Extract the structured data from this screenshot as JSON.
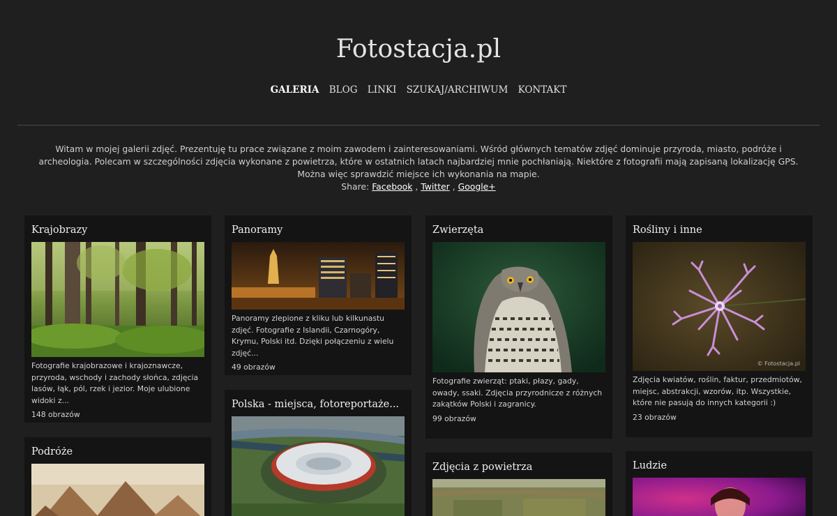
{
  "site": {
    "title": "Fotostacja.pl"
  },
  "nav": {
    "items": [
      {
        "label": "GALERIA",
        "active": true
      },
      {
        "label": "BLOG",
        "active": false
      },
      {
        "label": "LINKI",
        "active": false
      },
      {
        "label": "SZUKAJ/ARCHIWUM",
        "active": false
      },
      {
        "label": "KONTAKT",
        "active": false
      }
    ]
  },
  "intro": {
    "text": "Witam w mojej galerii zdjęć. Prezentuję tu prace związane z moim zawodem i zainteresowaniami. Wśród głównych tematów zdjęć dominuje przyroda, miasto, podróże i archeologia. Polecam w szczególności zdjęcia wykonane z powietrza, które w ostatnich latach najbardziej mnie pochłaniają. Niektóre z fotografii mają zapisaną lokalizację GPS. Można więc sprawdzić miejsce ich wykonania na mapie.",
    "share_label": "Share:",
    "share_links": [
      "Facebook",
      "Twitter",
      "Google+"
    ]
  },
  "galleries": [
    {
      "title": "Krajobrazy",
      "description": "Fotografie krajobrazowe i krajoznawcze, przyroda, wschody i zachody słońca, zdjęcia lasów, łąk, pól, rzek i jezior. Moje ulubione widoki z...",
      "count": "148 obrazów",
      "image": "forest-photo"
    },
    {
      "title": "Panoramy",
      "description": "Panoramy zlepione z kliku lub kilkunastu zdjęć. Fotografie z Islandii, Czarnogóry, Krymu, Polski itd. Dzięki połączeniu z wielu zdjęć...",
      "count": "49 obrazów",
      "image": "warsaw-night-panorama"
    },
    {
      "title": "Zwierzęta",
      "description": "Fotografie zwierząt: ptaki, płazy, gady, owady, ssaki. Zdjęcia przyrodnicze z różnych zakątków Polski i zagranicy.",
      "count": "99 obrazów",
      "image": "hawk-photo"
    },
    {
      "title": "Rośliny i inne",
      "description": "Zdjęcia kwiatów, roślin, faktur, przedmiotów, miejsc, abstrakcji, wzorów, itp. Wszystkie, które nie pasują do innych kategorii :)",
      "count": "23 obrazów",
      "image": "pink-flower-photo",
      "watermark": "© Fotostacja.pl"
    },
    {
      "title": "Podróże",
      "image": "pyramids-photo"
    },
    {
      "title": "Polska - miejsca, fotoreportaże...",
      "image": "stadium-aerial-photo"
    },
    {
      "title": "Zdjęcia z powietrza",
      "image": "aerial-landscape-photo"
    },
    {
      "title": "Ludzie",
      "image": "people-photo"
    }
  ]
}
